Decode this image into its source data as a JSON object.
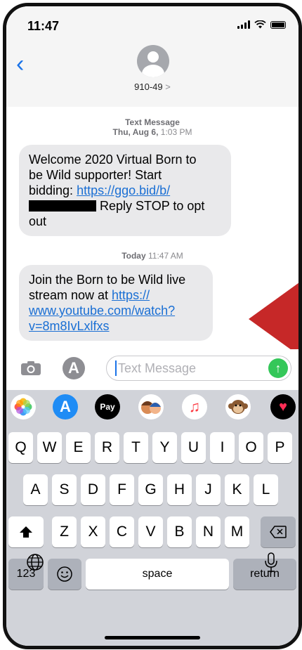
{
  "status_bar": {
    "time": "11:47"
  },
  "header": {
    "contact_name": "910-49",
    "contact_chevron": ">"
  },
  "messages": [
    {
      "meta_label": "Text Message",
      "meta_date": "Thu, Aug 6,",
      "meta_time": "1:03 PM",
      "line1": "Welcome 2020 Virtual Born to",
      "line2": "be Wild supporter! Start",
      "line3_text": "bidding: ",
      "line3_link": "https://ggo.bid/b/",
      "line4_text": " Reply STOP to opt",
      "line5": "out"
    },
    {
      "meta_date": "Today",
      "meta_time": "11:47 AM",
      "line1": "Join the Born to be Wild live",
      "line2_text": "stream now at ",
      "line2_link": "https://",
      "line3_link": "www.youtube.com/watch?",
      "line4_link": "v=8m8IvLxlfxs"
    }
  ],
  "input": {
    "placeholder": "Text Message"
  },
  "app_strip": [
    {
      "icon": "photos-icon",
      "color": "#ffffff"
    },
    {
      "icon": "appstore-icon",
      "color": "#1f8cf5"
    },
    {
      "icon": "apple-pay-icon",
      "label": "Pay",
      "color": "#000000"
    },
    {
      "icon": "memoji-icon",
      "color": "#ffffff"
    },
    {
      "icon": "music-icon",
      "color": "#ffffff"
    },
    {
      "icon": "monkey-animoji-icon",
      "color": "#ffffff"
    },
    {
      "icon": "digital-touch-icon",
      "color": "#000000"
    }
  ],
  "keyboard": {
    "row1": [
      "Q",
      "W",
      "E",
      "R",
      "T",
      "Y",
      "U",
      "I",
      "O",
      "P"
    ],
    "row2": [
      "A",
      "S",
      "D",
      "F",
      "G",
      "H",
      "J",
      "K",
      "L"
    ],
    "row3": [
      "Z",
      "X",
      "C",
      "V",
      "B",
      "N",
      "M"
    ],
    "numbers_key": "123",
    "space_key": "space",
    "return_key": "return"
  },
  "colors": {
    "link": "#1a6fd4",
    "bubble": "#e9e9eb",
    "send": "#34c759",
    "annotation_arrow": "#c62828"
  }
}
